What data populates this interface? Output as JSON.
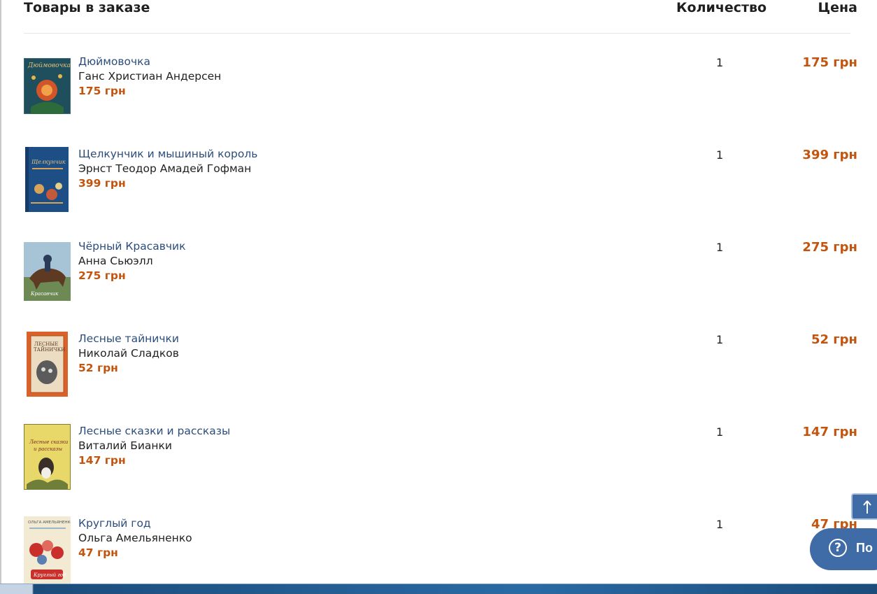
{
  "header": {
    "items_label": "Товары в заказе",
    "quantity_label": "Количество",
    "price_label": "Цена"
  },
  "items": [
    {
      "title": "Дюймовочка",
      "author": "Ганс Христиан Андерсен",
      "price": "175 грн",
      "quantity": "1",
      "total": "175 грн",
      "cover_colors": [
        "#1f4f5c",
        "#d2552a"
      ]
    },
    {
      "title": "Щелкунчик и мышиный король",
      "author": "Эрнст Теодор Амадей Гофман",
      "price": "399 грн",
      "quantity": "1",
      "total": "399 грн",
      "cover_colors": [
        "#1d4f86",
        "#d9a357"
      ]
    },
    {
      "title": "Чёрный Красавчик",
      "author": "Анна Сьюэлл",
      "price": "275 грн",
      "quantity": "1",
      "total": "275 грн",
      "cover_colors": [
        "#a7c3d6",
        "#5e3a22"
      ]
    },
    {
      "title": "Лесные тайнички",
      "author": "Николай Сладков",
      "price": "52 грн",
      "quantity": "1",
      "total": "52 грн",
      "cover_colors": [
        "#d9622b",
        "#ecddc2"
      ]
    },
    {
      "title": "Лесные сказки и рассказы",
      "author": "Виталий Бианки",
      "price": "147 грн",
      "quantity": "1",
      "total": "147 грн",
      "cover_colors": [
        "#e8d86a",
        "#6f7f3a"
      ]
    },
    {
      "title": "Круглый год",
      "author": "Ольга Амельяненко",
      "price": "47 грн",
      "quantity": "1",
      "total": "47 грн",
      "cover_colors": [
        "#f3ead4",
        "#c9302c"
      ]
    }
  ],
  "help_button": {
    "label": "По",
    "icon": "question-icon"
  },
  "scroll_top_button": {
    "icon": "arrow-up-icon"
  }
}
